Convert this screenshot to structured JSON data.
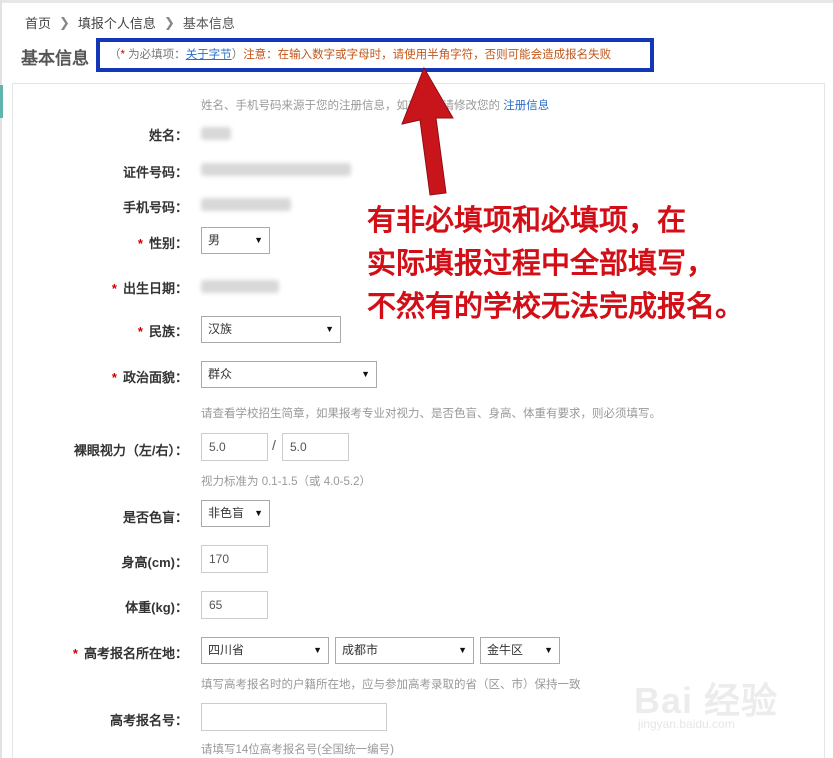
{
  "breadcrumb": {
    "home": "首页",
    "step": "填报个人信息",
    "current": "基本信息"
  },
  "page_title": "基本信息",
  "notice": {
    "open_paren": "（",
    "required_mark": "*",
    "required_text": " 为必填项：",
    "font_size_link": "关于字节",
    "close_paren": "）",
    "warning": "注意：在输入数字或字母时，请使用半角字符，否则可能会造成报名失败"
  },
  "info_hint": {
    "text": "姓名、手机号码来源于您的注册信息，如有错误请修改您的",
    "link": "注册信息"
  },
  "fields": {
    "name_label": "姓名：",
    "id_label": "证件号码：",
    "phone_label": "手机号码：",
    "gender_label": "性别：",
    "gender_value": "男",
    "birth_label": "出生日期：",
    "ethnicity_label": "民族：",
    "ethnicity_value": "汉族",
    "political_label": "政治面貌：",
    "political_value": "群众",
    "physical_hint": "请查看学校招生简章，如果报考专业对视力、是否色盲、身高、体重有要求，则必须填写。",
    "vision_label": "裸眼视力（左/右）：",
    "vision_left": "5.0",
    "vision_right": "5.0",
    "vision_slash": "/",
    "vision_hint": "视力标准为 0.1-1.5（或 4.0-5.2）",
    "colorblind_label": "是否色盲：",
    "colorblind_value": "非色盲",
    "height_label": "身高(cm)：",
    "height_value": "170",
    "weight_label": "体重(kg)：",
    "weight_value": "65",
    "location_label": "高考报名所在地：",
    "province_value": "四川省",
    "city_value": "成都市",
    "district_value": "金牛区",
    "location_hint": "填写高考报名时的户籍所在地，应与参加高考录取的省（区、市）保持一致",
    "exam_no_label": "高考报名号：",
    "exam_no_value": "",
    "exam_no_hint": "请填写14位高考报名号(全国统一编号)"
  },
  "required_star": "*",
  "annotation": {
    "line1": "有非必填项和必填项，在",
    "line2": "实际填报过程中全部填写，",
    "line3": "不然有的学校无法完成报名。"
  },
  "watermark": {
    "main": "Bai 经验",
    "sub": "jingyan.baidu.com"
  },
  "colors": {
    "notice_border": "#1437b8",
    "annotation": "#d20f17",
    "required": "#cc0000",
    "link": "#2a6fc9"
  }
}
